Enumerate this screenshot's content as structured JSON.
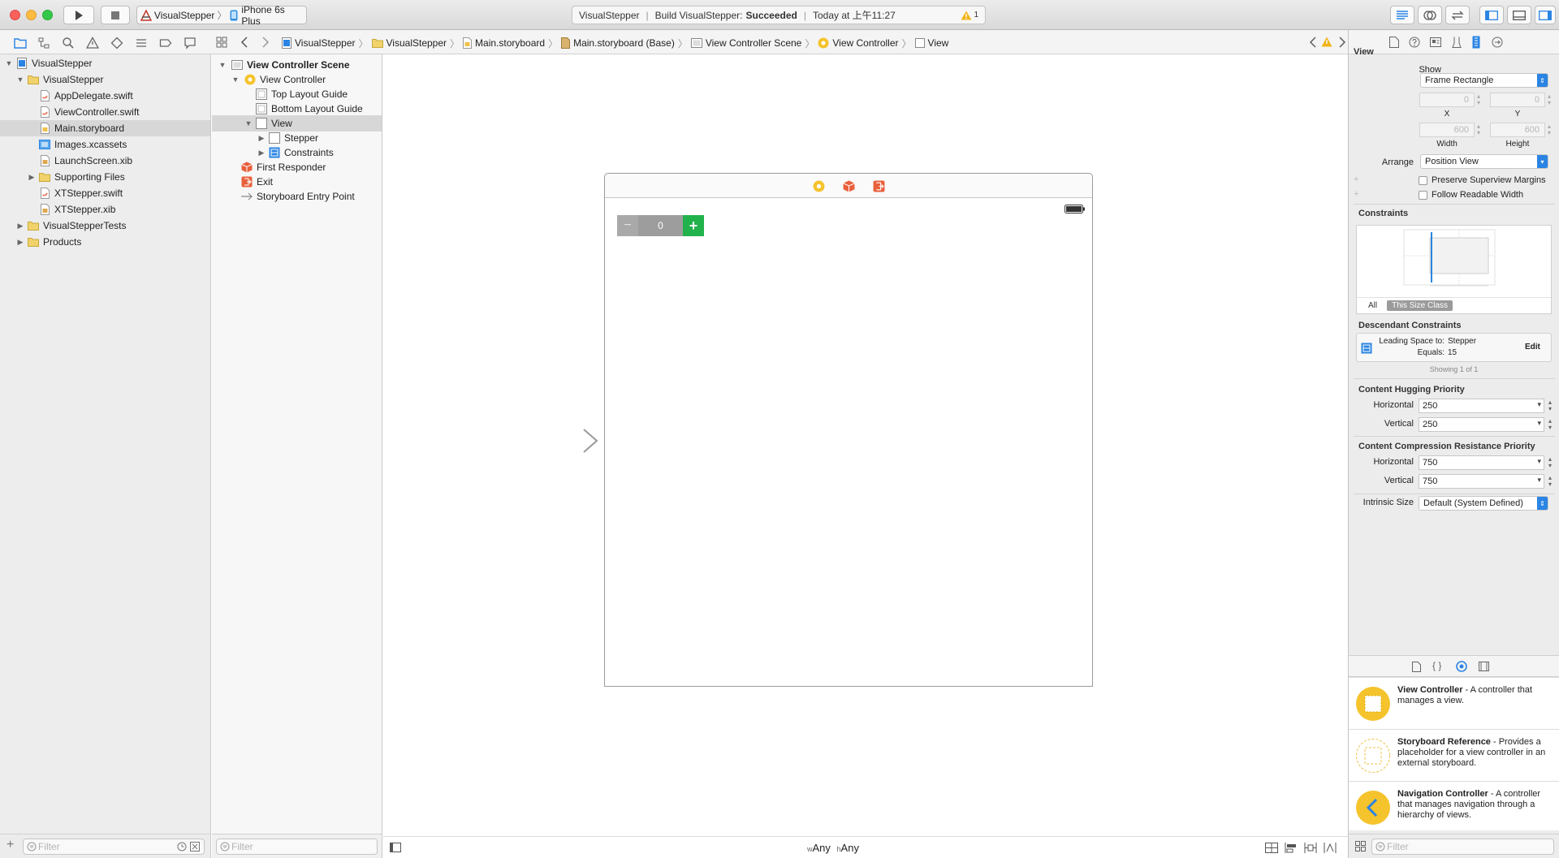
{
  "toolbar": {
    "scheme_name": "VisualStepper",
    "device_name": "iPhone 6s Plus",
    "activity_project": "VisualStepper",
    "activity_build_prefix": "Build VisualStepper:",
    "activity_build_status": "Succeeded",
    "activity_time": "Today at 上午11:27",
    "warning_count": "1"
  },
  "jumpbar": {
    "items": [
      "VisualStepper",
      "VisualStepper",
      "Main.storyboard",
      "Main.storyboard (Base)",
      "View Controller Scene",
      "View Controller",
      "View"
    ]
  },
  "navigator": {
    "items": [
      {
        "label": "VisualStepper"
      },
      {
        "label": "VisualStepper"
      },
      {
        "label": "AppDelegate.swift"
      },
      {
        "label": "ViewController.swift"
      },
      {
        "label": "Main.storyboard"
      },
      {
        "label": "Images.xcassets"
      },
      {
        "label": "LaunchScreen.xib"
      },
      {
        "label": "Supporting Files"
      },
      {
        "label": "XTStepper.swift"
      },
      {
        "label": "XTStepper.xib"
      },
      {
        "label": "VisualStepperTests"
      },
      {
        "label": "Products"
      }
    ],
    "filter_placeholder": "Filter"
  },
  "outline": {
    "items": [
      {
        "label": "View Controller Scene"
      },
      {
        "label": "View Controller"
      },
      {
        "label": "Top Layout Guide"
      },
      {
        "label": "Bottom Layout Guide"
      },
      {
        "label": "View"
      },
      {
        "label": "Stepper"
      },
      {
        "label": "Constraints"
      },
      {
        "label": "First Responder"
      },
      {
        "label": "Exit"
      },
      {
        "label": "Storyboard Entry Point"
      }
    ],
    "filter_placeholder": "Filter"
  },
  "canvas": {
    "stepper_minus": "−",
    "stepper_value": "0",
    "stepper_plus": "+",
    "size_w_prefix": "w",
    "size_w_value": "Any",
    "size_h_prefix": "h",
    "size_h_value": "Any"
  },
  "inspector": {
    "title": "View",
    "show_label": "Show",
    "show_value": "Frame Rectangle",
    "x_value": "0",
    "y_value": "0",
    "x_label": "X",
    "y_label": "Y",
    "width_value": "600",
    "height_value": "600",
    "width_label": "Width",
    "height_label": "Height",
    "arrange_label": "Arrange",
    "arrange_value": "Position View",
    "preserve_margins": "Preserve Superview Margins",
    "follow_readable": "Follow Readable Width",
    "constraints_title": "Constraints",
    "tab_all": "All",
    "tab_size_class": "This Size Class",
    "descendant_title": "Descendant Constraints",
    "constraint_line1_label": "Leading Space to:",
    "constraint_line1_value": "Stepper",
    "constraint_line2_label": "Equals:",
    "constraint_line2_value": "15",
    "edit_label": "Edit",
    "showing": "Showing 1 of 1",
    "hugging_title": "Content Hugging Priority",
    "horizontal_label": "Horizontal",
    "vertical_label": "Vertical",
    "hug_h": "250",
    "hug_v": "250",
    "compression_title": "Content Compression Resistance Priority",
    "comp_h": "750",
    "comp_v": "750",
    "intrinsic_label": "Intrinsic Size",
    "intrinsic_value": "Default (System Defined)"
  },
  "library": {
    "items": [
      {
        "title": "View Controller",
        "desc": " - A controller that manages a view."
      },
      {
        "title": "Storyboard Reference",
        "desc": " - Provides a placeholder for a view controller in an external storyboard."
      },
      {
        "title": "Navigation Controller",
        "desc": " - A controller that manages navigation through a hierarchy of views."
      }
    ],
    "filter_placeholder": "Filter"
  },
  "colors": {
    "accent": "#2a84e3",
    "stepper_plus": "#22b24c",
    "stepper_gray": "#a9a9a9",
    "vc_yellow": "#f5c32c",
    "responder_red": "#e8603c"
  }
}
